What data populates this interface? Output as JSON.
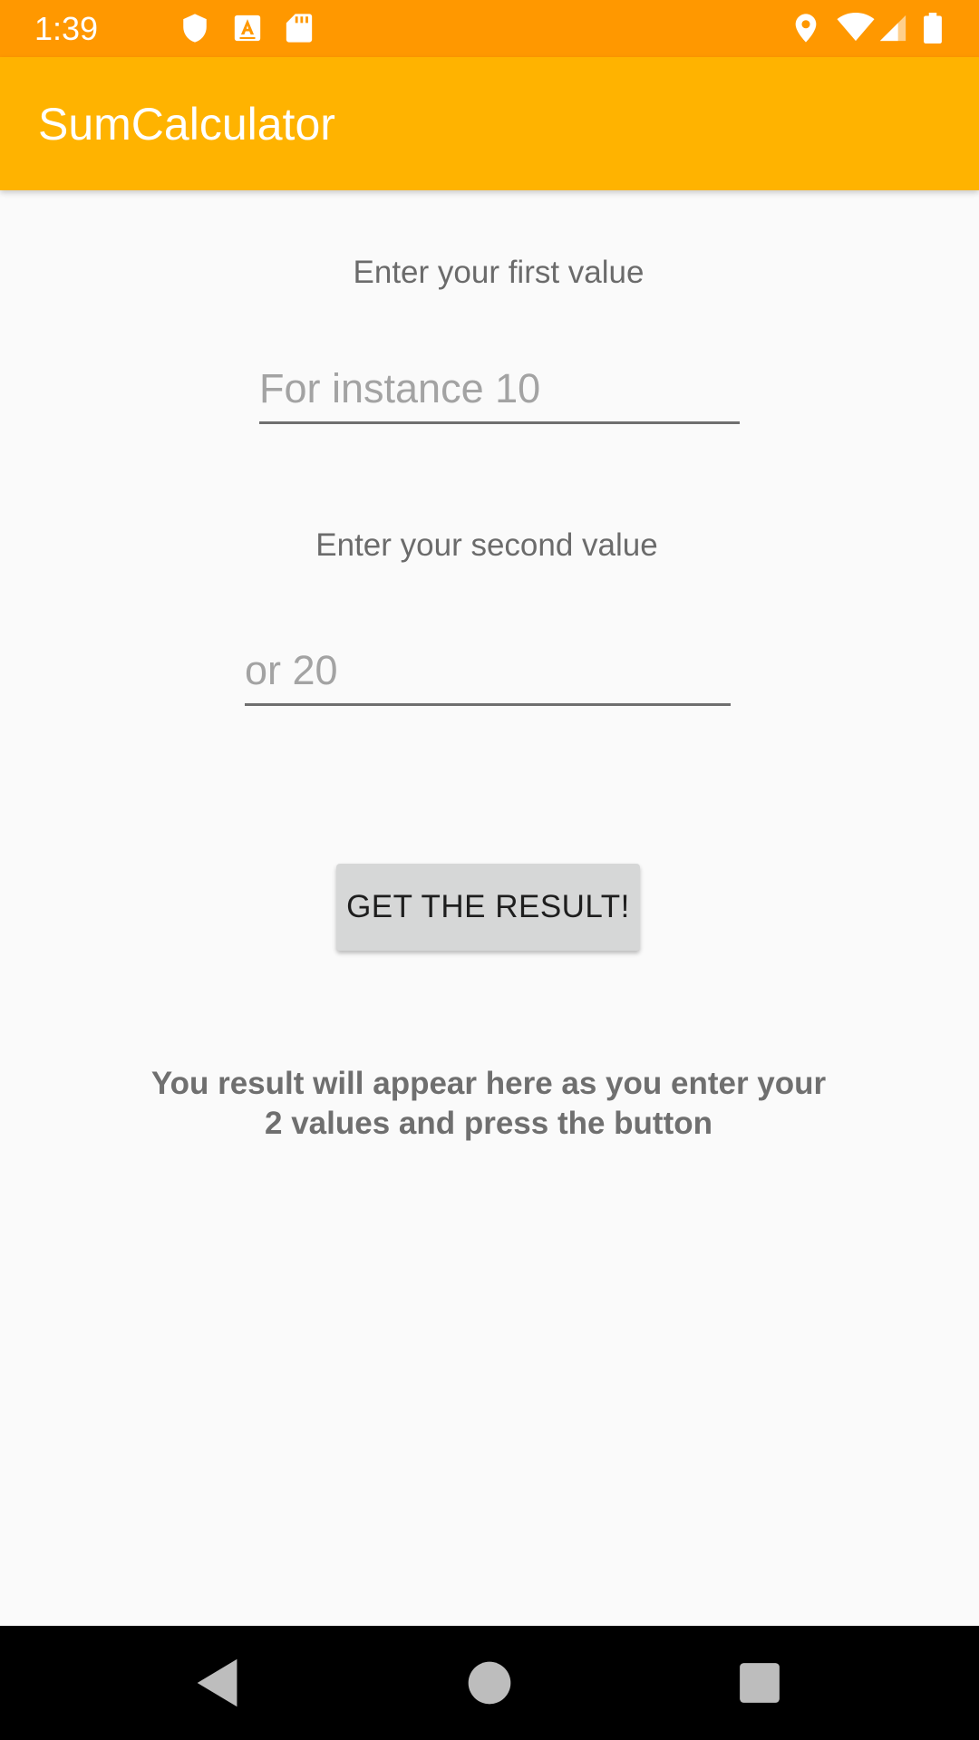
{
  "status_bar": {
    "time": "1:39",
    "icons": [
      "shield-icon",
      "text-a-icon",
      "sd-card-icon",
      "location-icon",
      "wifi-icon",
      "signal-icon",
      "battery-icon"
    ],
    "background": "#ff9800"
  },
  "app_bar": {
    "title": "SumCalculator",
    "background": "#ffb300"
  },
  "form": {
    "first_label": "Enter your first value",
    "first_placeholder": "For instance 10",
    "first_value": "",
    "second_label": "Enter your second value",
    "second_placeholder": "or 20",
    "second_value": "",
    "button_label": "GET THE RESULT!",
    "result_text": "You result will appear here as you enter your 2 values and press the button"
  },
  "nav_bar": {
    "buttons": [
      "back-icon",
      "home-icon",
      "recents-icon"
    ]
  }
}
